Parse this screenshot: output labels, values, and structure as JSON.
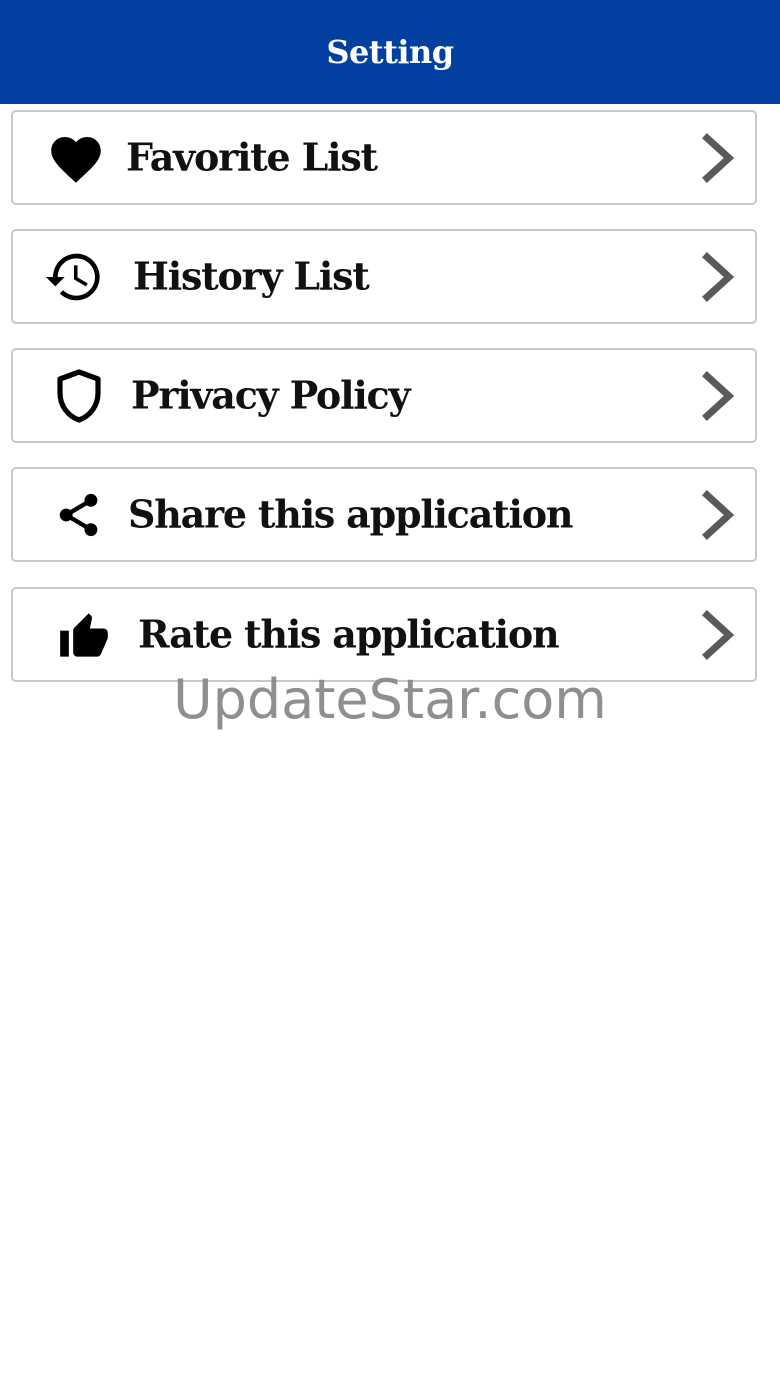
{
  "header": {
    "title": "Setting",
    "background_color": "#0140a1"
  },
  "menu": {
    "items": [
      {
        "label": "Favorite List",
        "icon": "heart-icon"
      },
      {
        "label": "History List",
        "icon": "history-icon"
      },
      {
        "label": "Privacy Policy",
        "icon": "shield-icon"
      },
      {
        "label": "Share this application",
        "icon": "share-icon"
      },
      {
        "label": "Rate this application",
        "icon": "thumbs-up-icon"
      }
    ],
    "chevron_icon": "chevron-right-icon"
  },
  "watermark": {
    "text": "UpdateStar.com"
  }
}
